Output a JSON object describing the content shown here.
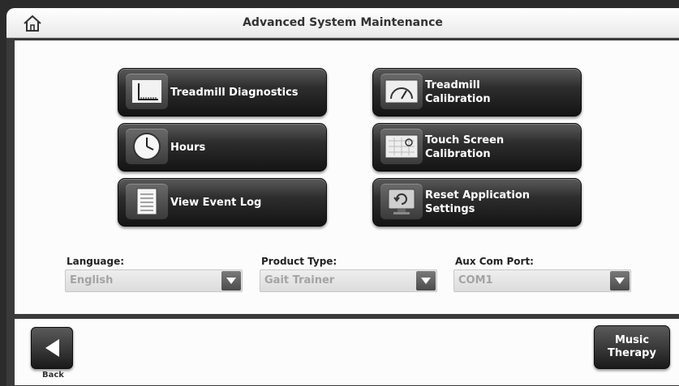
{
  "header": {
    "title": "Advanced System Maintenance",
    "home_icon": "home-icon"
  },
  "buttons": {
    "treadmill_diagnostics": "Treadmill Diagnostics",
    "treadmill_calibration": "Treadmill\nCalibration",
    "hours": "Hours",
    "touch_screen_calibration": "Touch Screen\nCalibration",
    "view_event_log": "View Event Log",
    "reset_application_settings": "Reset Application\nSettings"
  },
  "settings": {
    "language": {
      "label": "Language:",
      "value": "English"
    },
    "product_type": {
      "label": "Product Type:",
      "value": "Gait Trainer"
    },
    "aux_com_port": {
      "label": "Aux Com Port:",
      "value": "COM1"
    }
  },
  "footer": {
    "back_label": "Back",
    "music_therapy": "Music\nTherapy"
  },
  "colors": {
    "button_dark": "#1e1e1e",
    "dropdown_value": "#a3a3a3",
    "frame": "#3a3a3a"
  }
}
